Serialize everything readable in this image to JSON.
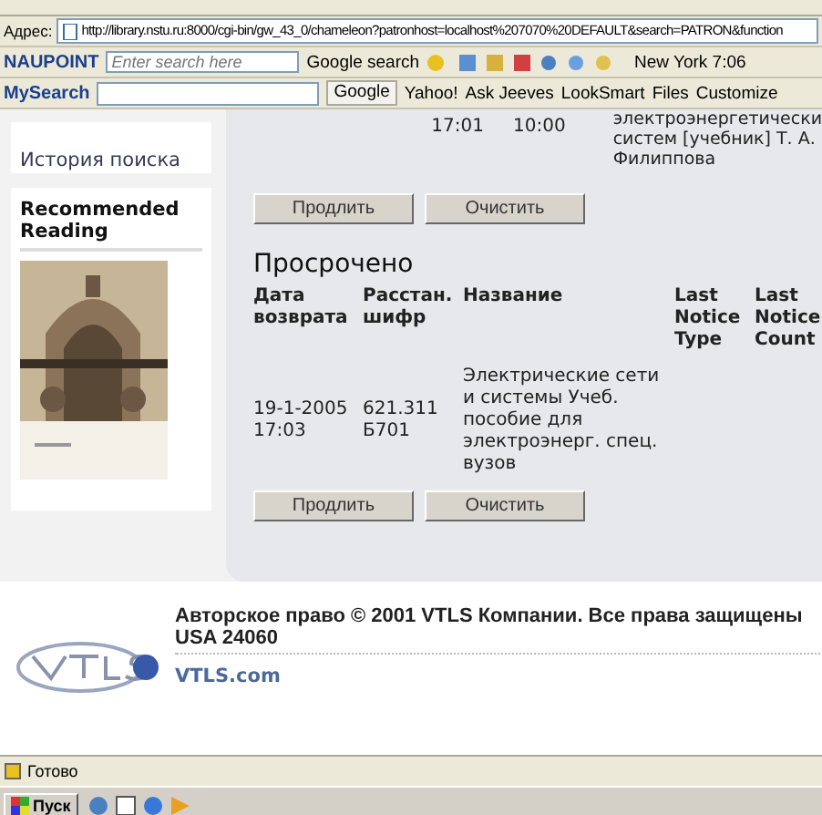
{
  "address_bar": {
    "label": "Адрес:",
    "url": "http://library.nstu.ru:8000/cgi-bin/gw_43_0/chameleon?patronhost=localhost%207070%20DEFAULT&search=PATRON&function"
  },
  "toolbar_1": {
    "brand": "NAUPOINT",
    "search_placeholder": "Enter search here",
    "google_search": "Google search",
    "clock": "New York 7:06"
  },
  "toolbar_2": {
    "brand": "MySearch",
    "buttons": [
      "Google",
      "Yahoo!",
      "Ask Jeeves",
      "LookSmart",
      "Files",
      "Customize"
    ]
  },
  "sidebar": {
    "search_history": "История поиска",
    "recommended_title": "Recommended Reading"
  },
  "loans": {
    "checkout_time": "17:01",
    "due_time": "10:00",
    "title_lines": [
      "электроэнергетически",
      "систем [учебник] Т. А.",
      "Филиппова"
    ],
    "buttons": [
      "Продлить",
      "Очистить"
    ]
  },
  "overdue": {
    "heading": "Просрочено",
    "columns": [
      "Дата возврата",
      "Расстан. шифр",
      "Название",
      "Last Notice Type",
      "Last Notice Count"
    ],
    "rows": [
      {
        "cells": [
          "19-1-2005 17:03",
          "621.311 Б701",
          "Электрические сети и системы Учеб. пособие для электроэнерг. спец. вузов"
        ]
      }
    ],
    "buttons": [
      "Продлить",
      "Очистить"
    ]
  },
  "footer": {
    "copyright": "Авторское право © 2001 VTLS Компании. Все права защищены",
    "address": "USA 24060",
    "link": "VTLS.com"
  },
  "status_bar": {
    "text": "Готово"
  },
  "taskbar": {
    "start": "Пуск"
  }
}
